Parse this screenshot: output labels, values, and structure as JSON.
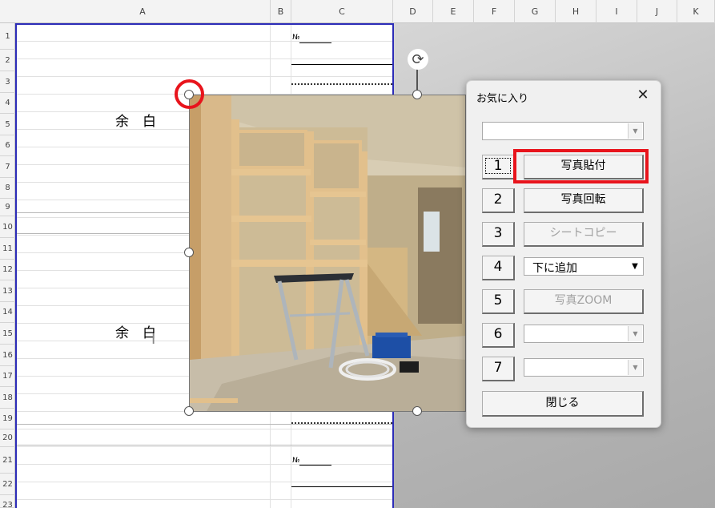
{
  "sheet": {
    "columns": [
      "A",
      "B",
      "C",
      "D",
      "E",
      "F",
      "G",
      "H",
      "I",
      "J",
      "K"
    ],
    "rows": [
      "1",
      "2",
      "3",
      "4",
      "5",
      "6",
      "7",
      "8",
      "9",
      "10",
      "11",
      "12",
      "13",
      "14",
      "15",
      "16",
      "17",
      "18",
      "19",
      "20",
      "21",
      "22",
      "23"
    ],
    "margin_text_1": "余　白",
    "margin_text_2": "余　白",
    "small_label_1": "№",
    "small_label_2": "№"
  },
  "dialog": {
    "title": "お気に入り",
    "close_glyph": "✕",
    "top_combo_value": "",
    "buttons": [
      {
        "num": "1",
        "label": "写真貼付",
        "enabled": true
      },
      {
        "num": "2",
        "label": "写真回転",
        "enabled": true
      },
      {
        "num": "3",
        "label": "シートコピー",
        "enabled": false
      },
      {
        "num": "4",
        "label": "下に追加",
        "enabled": true
      },
      {
        "num": "5",
        "label": "写真ZOOM",
        "enabled": false
      },
      {
        "num": "6",
        "label": "",
        "enabled": true
      },
      {
        "num": "7",
        "label": "",
        "enabled": true
      }
    ],
    "close_label": "閉じる"
  },
  "colors": {
    "highlight": "#e8141c",
    "print_border": "#2c2cb8"
  },
  "icons": {
    "rotate": "rotate-handle-icon",
    "close": "close-icon",
    "dropdown": "chevron-down-icon"
  }
}
